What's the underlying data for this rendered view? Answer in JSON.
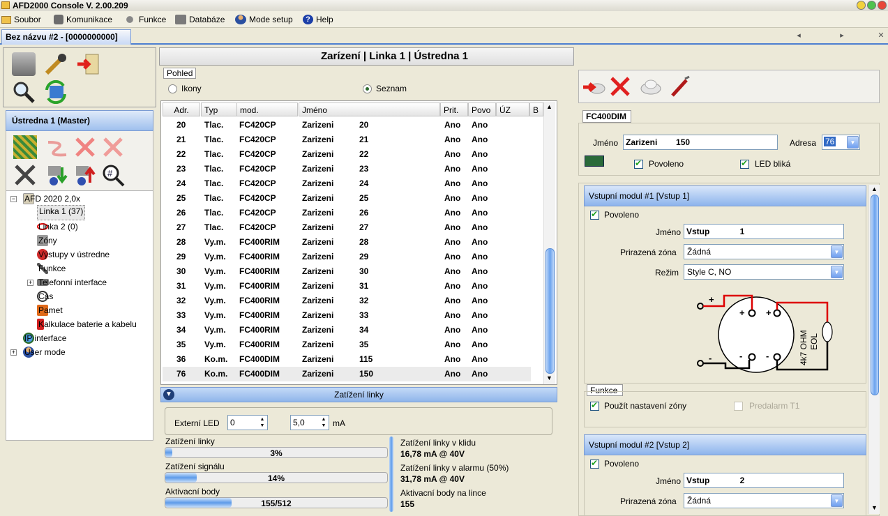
{
  "app": {
    "title": "AFD2000 Console V. 2.00.209"
  },
  "menu": [
    "Soubor",
    "Komunikace",
    "Funkce",
    "Databáze",
    "Mode setup",
    "Help"
  ],
  "doc_tab": "Bez názvu #2 - [0000000000]",
  "left": {
    "panel_title": "Ústredna 1 (Master)",
    "tree": [
      {
        "label": "AFD 2020 2,0x"
      },
      {
        "label": "Linka 1 (37)"
      },
      {
        "label": "Linka 2 (0)"
      },
      {
        "label": "Zóny"
      },
      {
        "label": "Výstupy v ústredne"
      },
      {
        "label": "Funkce"
      },
      {
        "label": "Telefonní interface"
      },
      {
        "label": "Cas"
      },
      {
        "label": "Pamet"
      },
      {
        "label": "Kalkulace baterie a kabelu"
      },
      {
        "label": "IP interface"
      },
      {
        "label": "User mode"
      }
    ]
  },
  "center": {
    "header": "Zarízení | Linka 1 | Ústredna 1",
    "view_group": "Pohled",
    "view_options": [
      "Ikony",
      "Seznam"
    ],
    "view_selected": "Seznam",
    "columns": [
      "Adr.",
      "Typ",
      "mod.",
      "Jméno",
      "Prit.",
      "Povo",
      "ÚZ",
      "B"
    ],
    "rows": [
      [
        "20",
        "Tlac.",
        "FC420CP",
        "Zarizeni",
        "20",
        "Ano",
        "Ano"
      ],
      [
        "21",
        "Tlac.",
        "FC420CP",
        "Zarizeni",
        "21",
        "Ano",
        "Ano"
      ],
      [
        "22",
        "Tlac.",
        "FC420CP",
        "Zarizeni",
        "22",
        "Ano",
        "Ano"
      ],
      [
        "23",
        "Tlac.",
        "FC420CP",
        "Zarizeni",
        "23",
        "Ano",
        "Ano"
      ],
      [
        "24",
        "Tlac.",
        "FC420CP",
        "Zarizeni",
        "24",
        "Ano",
        "Ano"
      ],
      [
        "25",
        "Tlac.",
        "FC420CP",
        "Zarizeni",
        "25",
        "Ano",
        "Ano"
      ],
      [
        "26",
        "Tlac.",
        "FC420CP",
        "Zarizeni",
        "26",
        "Ano",
        "Ano"
      ],
      [
        "27",
        "Tlac.",
        "FC420CP",
        "Zarizeni",
        "27",
        "Ano",
        "Ano"
      ],
      [
        "28",
        "Vy.m.",
        "FC400RIM",
        "Zarizeni",
        "28",
        "Ano",
        "Ano"
      ],
      [
        "29",
        "Vy.m.",
        "FC400RIM",
        "Zarizeni",
        "29",
        "Ano",
        "Ano"
      ],
      [
        "30",
        "Vy.m.",
        "FC400RIM",
        "Zarizeni",
        "30",
        "Ano",
        "Ano"
      ],
      [
        "31",
        "Vy.m.",
        "FC400RIM",
        "Zarizeni",
        "31",
        "Ano",
        "Ano"
      ],
      [
        "32",
        "Vy.m.",
        "FC400RIM",
        "Zarizeni",
        "32",
        "Ano",
        "Ano"
      ],
      [
        "33",
        "Vy.m.",
        "FC400RIM",
        "Zarizeni",
        "33",
        "Ano",
        "Ano"
      ],
      [
        "34",
        "Vy.m.",
        "FC400RIM",
        "Zarizeni",
        "34",
        "Ano",
        "Ano"
      ],
      [
        "35",
        "Vy.m.",
        "FC400RIM",
        "Zarizeni",
        "35",
        "Ano",
        "Ano"
      ],
      [
        "36",
        "Ko.m.",
        "FC400DIM",
        "Zarizeni",
        "115",
        "Ano",
        "Ano"
      ],
      [
        "76",
        "Ko.m.",
        "FC400DIM",
        "Zarizeni",
        "150",
        "Ano",
        "Ano"
      ]
    ],
    "load": {
      "title": "Zatížení linky",
      "ext_led_label": "Externí LED",
      "ext_led_value": "0",
      "ma_value": "5,0",
      "ma_unit": "mA",
      "bars": [
        {
          "label": "Zatížení linky",
          "text": "3%",
          "fraction": 0.03
        },
        {
          "label": "Zatížení signálu",
          "text": "14%",
          "fraction": 0.14
        },
        {
          "label": "Aktivacní body",
          "text": "155/512",
          "fraction": 0.3
        }
      ],
      "stats": [
        {
          "label": "Zatížení linky v klidu",
          "value": "16,78 mA @ 40V"
        },
        {
          "label": "Zatížení linky v alarmu (50%)",
          "value": "31,78 mA @ 40V"
        },
        {
          "label": "Aktivacní body na lince",
          "value": "155"
        }
      ]
    }
  },
  "right": {
    "device_model": "FC400DIM",
    "name_label": "Jméno",
    "name_value": "Zarizeni        150",
    "address_label": "Adresa",
    "address_value": "76",
    "enabled_label": "Povoleno",
    "led_label": "LED bliká",
    "module1": {
      "title": "Vstupní modul #1 [Vstup              1]",
      "enabled_label": "Povoleno",
      "name_label": "Jméno",
      "name_value": "Vstup             1",
      "zone_label": "Prirazená zóna",
      "zone_value": "Žádná",
      "mode_label": "Režim",
      "mode_value": "Style C, NO",
      "diagram": {
        "plus": "+",
        "minus": "-",
        "eol_text": "4k7 OHM",
        "eol_label": "EOL"
      }
    },
    "funkce": {
      "title": "Funkce",
      "use_zone_label": "Použít nastavení zóny",
      "prealarm_label": "Predalarm T1"
    },
    "module2": {
      "title": "Vstupní modul #2 [Vstup              2]",
      "enabled_label": "Povoleno",
      "name_label": "Jméno",
      "name_value": "Vstup             2",
      "zone_label": "Prirazená zóna",
      "zone_value": "Žádná"
    }
  }
}
